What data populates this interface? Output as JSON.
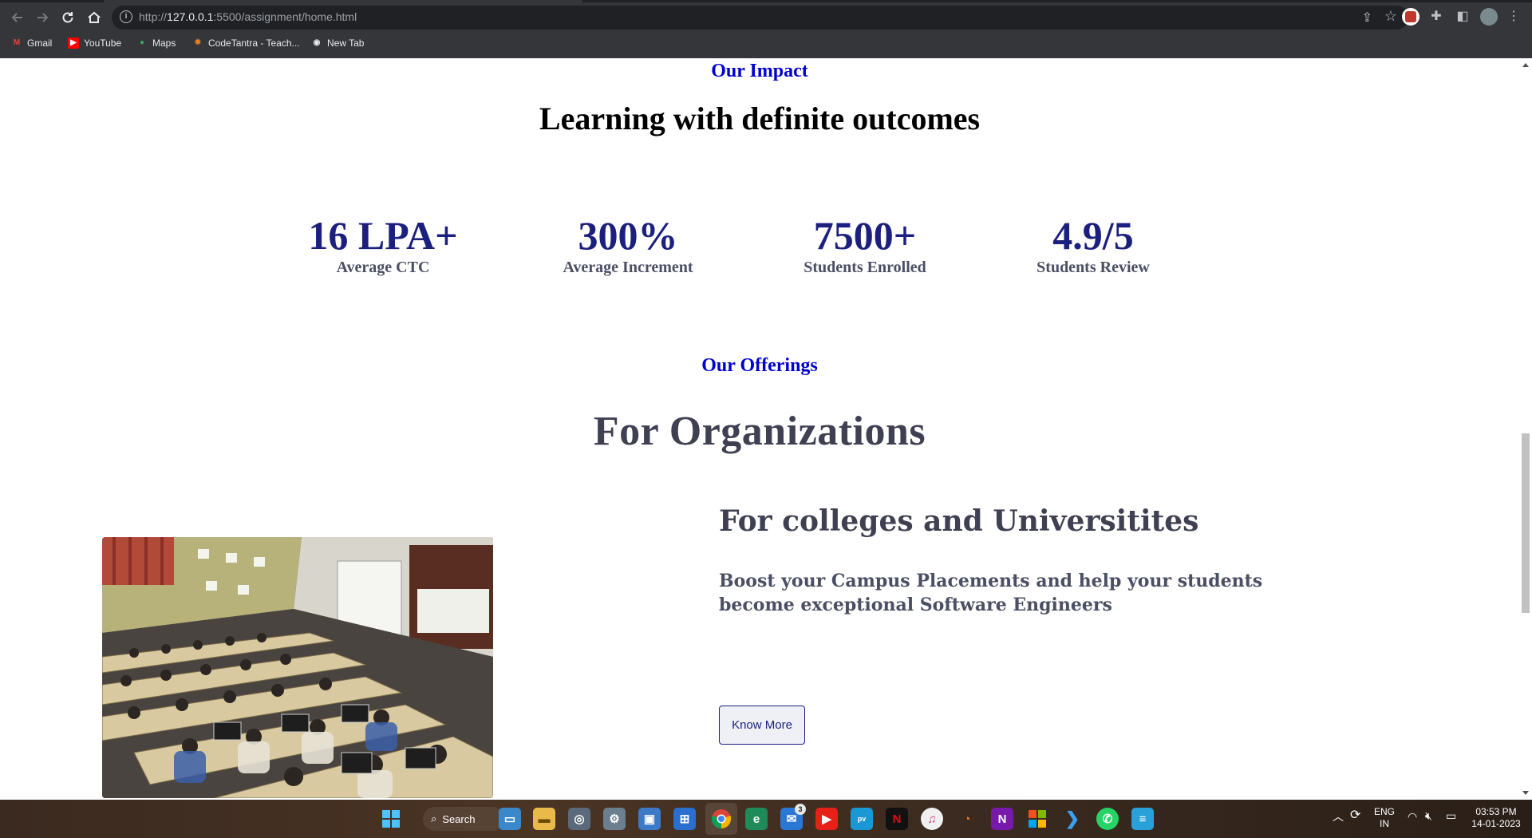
{
  "browser": {
    "url_prefix": "http://",
    "url_host": "127.0.0.1",
    "url_rest": ":5500/assignment/home.html",
    "bookmarks": [
      {
        "label": "Gmail",
        "icon": "gmail-icon",
        "color": "#ea4335"
      },
      {
        "label": "YouTube",
        "icon": "youtube-icon",
        "color": "#ff0000"
      },
      {
        "label": "Maps",
        "icon": "maps-icon",
        "color": "#34a853"
      },
      {
        "label": "CodeTantra - Teach...",
        "icon": "codetantra-icon",
        "color": "#e67e22"
      },
      {
        "label": "New Tab",
        "icon": "globe-icon",
        "color": "#e8eaed"
      }
    ]
  },
  "impact": {
    "eyebrow": "Our Impact",
    "headline": "Learning with definite outcomes",
    "stats": [
      {
        "value": "16 LPA+",
        "label": "Average CTC"
      },
      {
        "value": "300%",
        "label": "Average Increment"
      },
      {
        "value": "7500+",
        "label": "Students Enrolled"
      },
      {
        "value": "4.9/5",
        "label": "Students Review"
      }
    ]
  },
  "offerings": {
    "eyebrow": "Our Offerings",
    "title": "For Organizations",
    "card": {
      "title": "For colleges and Universitites",
      "description": "Boost your Campus Placements and help your students become exceptional Software Engineers",
      "button_label": "Know More",
      "image": "lecture-hall-photo"
    }
  },
  "taskbar": {
    "search_label": "Search",
    "mail_badge": "3",
    "language": "ENG",
    "region": "IN",
    "time": "03:53 PM",
    "date": "14-01-2023"
  },
  "colors": {
    "accent_blue": "#0000cd",
    "stat_navy": "#1b1f7d",
    "heading_slate": "#3f4152"
  }
}
